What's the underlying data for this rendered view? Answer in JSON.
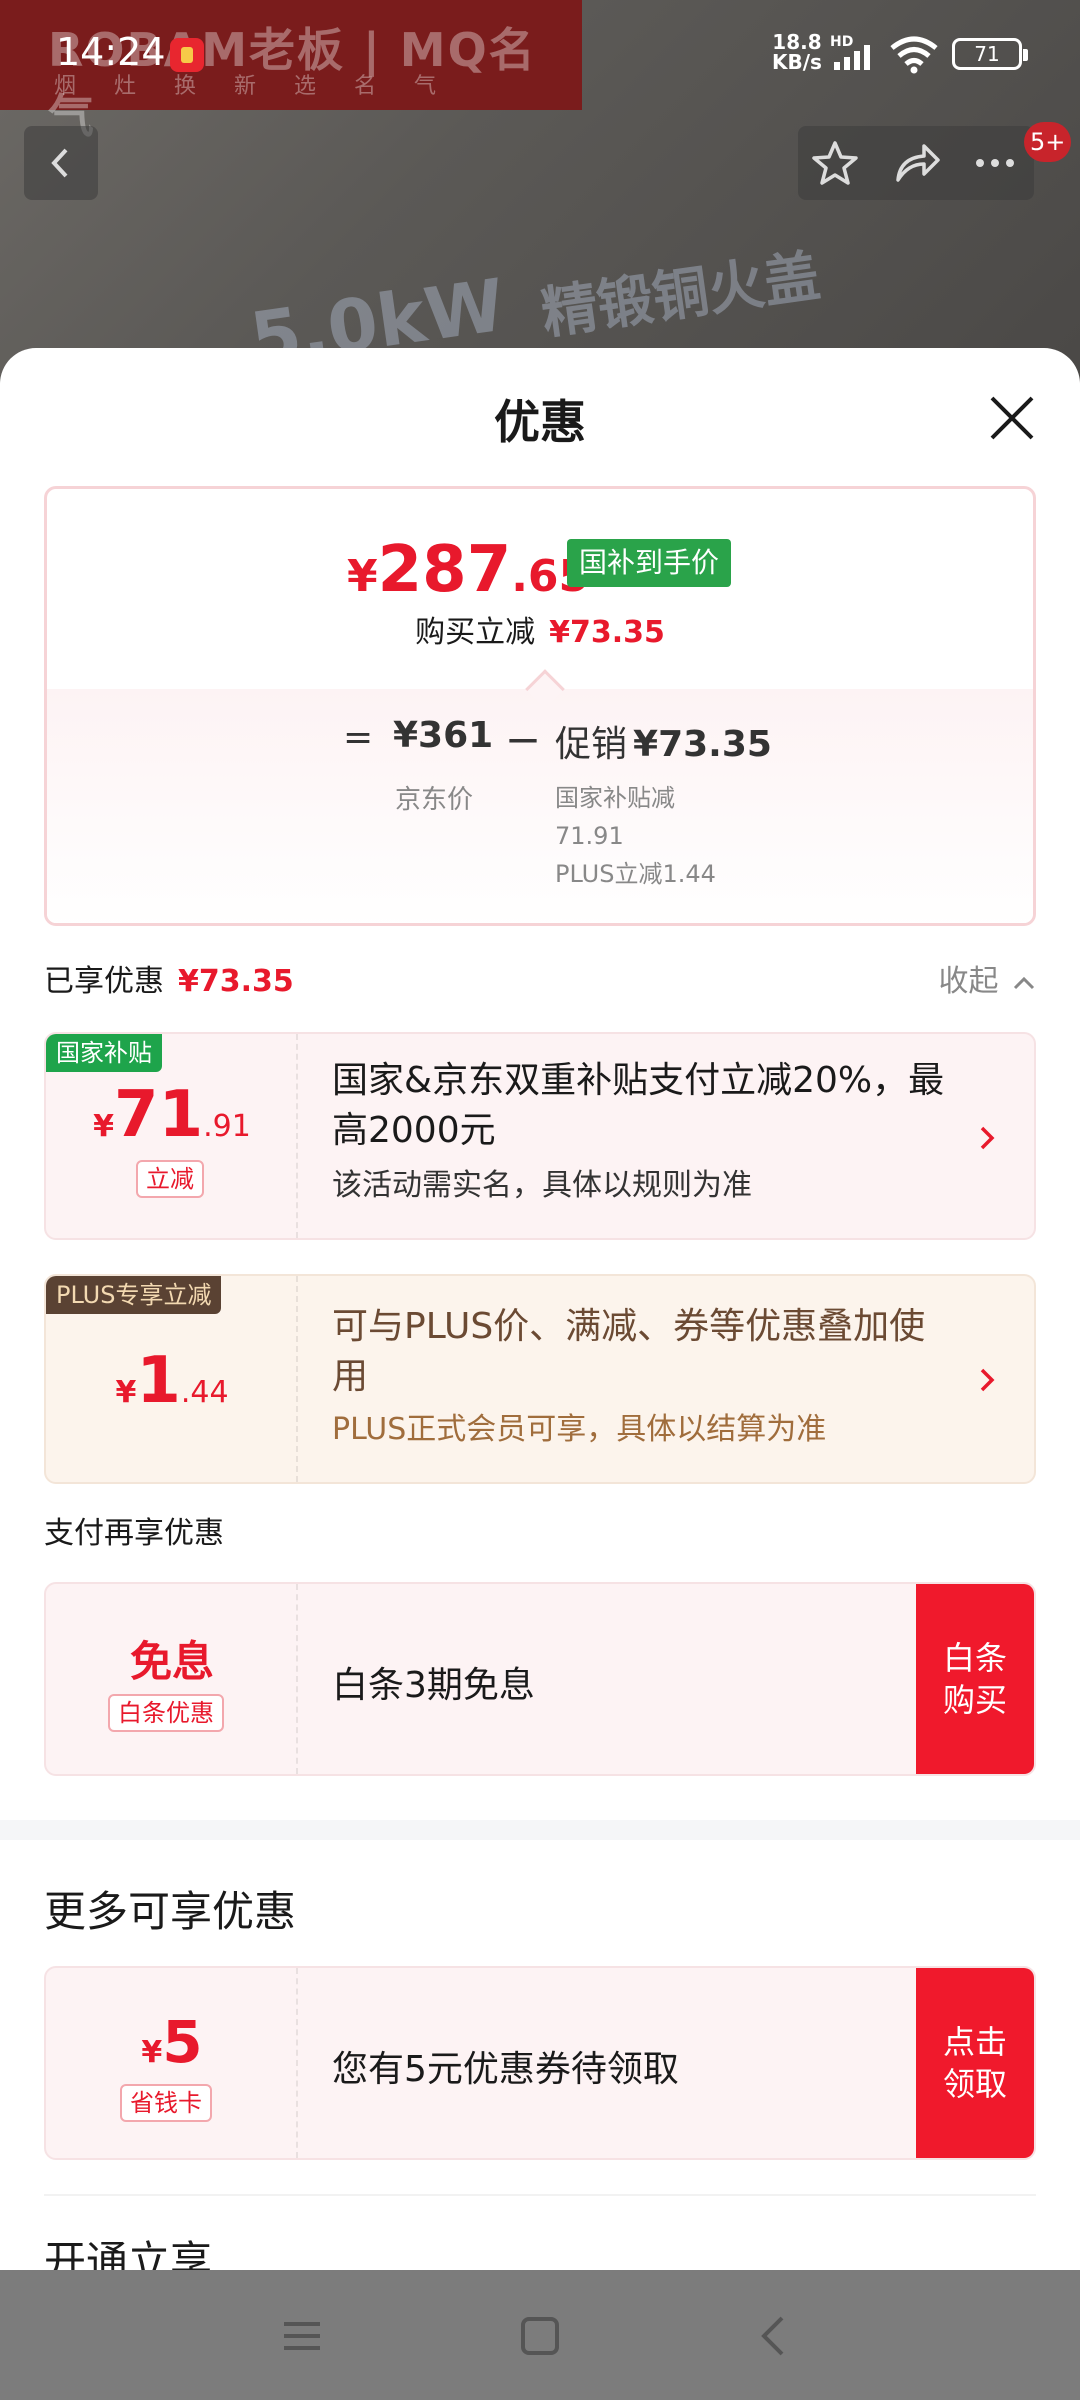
{
  "status_bar": {
    "time": "14:24",
    "net_speed": "18.8",
    "net_unit": "KB/s",
    "hd_label": "HD",
    "battery": "71"
  },
  "background": {
    "brand_text": "ROBAM老板 | MQ名气",
    "slogan_text": "烟灶换新选名气",
    "product_text": "5.0kW",
    "product_text2": "精锻铜火盖",
    "message_badge": "5+"
  },
  "sheet": {
    "title": "优惠",
    "summary": {
      "currency": "¥",
      "final_int": "287",
      "final_dec": ".65",
      "final_tag": "国补到手价",
      "instant_cut_label": "购买立减",
      "instant_cut_amount": "¥73.35",
      "eq": "=",
      "jd_price": "¥361",
      "jd_label": "京东价",
      "minus": "－",
      "promo_label": "促销",
      "promo_amount": "¥73.35",
      "promo_detail_1": "国家补贴减",
      "promo_detail_2": "71.91",
      "promo_detail_3": "PLUS立减1.44"
    },
    "enjoyed": {
      "label": "已享优惠",
      "amount": "¥73.35",
      "collapse_label": "收起"
    },
    "national_subsidy": {
      "tag": "国家补贴",
      "currency": "¥",
      "int": "71",
      "dec": ".91",
      "sub_tag": "立减",
      "title": "国家&京东双重补贴支付立减20%，最高2000元",
      "desc": "该活动需实名，具体以规则为准"
    },
    "plus": {
      "tag": "PLUS专享立减",
      "currency": "¥",
      "int": "1",
      "dec": ".44",
      "title": "可与PLUS价、满减、券等优惠叠加使用",
      "desc": "PLUS正式会员可享，具体以结算为准"
    },
    "pay_heading": "支付再享优惠",
    "baitiao": {
      "big": "免息",
      "sub_tag": "白条优惠",
      "text": "白条3期免息",
      "action": "白条购买"
    },
    "more_heading": "更多可享优惠",
    "save_card": {
      "currency": "¥",
      "int": "5",
      "sub_tag": "省钱卡",
      "text": "您有5元优惠券待领取",
      "action": "点击领取"
    },
    "open_heading": "开通立享"
  },
  "colors": {
    "accent_red": "#e8192c",
    "subsidy_green": "#1ea44b",
    "plus_brown": "#5a4233"
  },
  "icons": [
    "back-icon",
    "star-icon",
    "share-icon",
    "more-icon",
    "close-icon",
    "chevron-up-icon",
    "chevron-right-icon",
    "menu-icon",
    "home-icon",
    "back-triangle-icon"
  ]
}
